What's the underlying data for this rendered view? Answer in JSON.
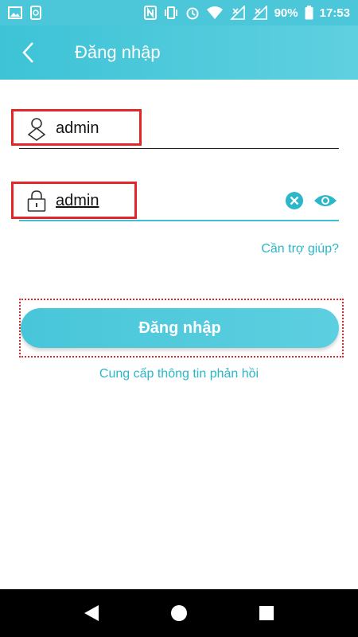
{
  "status_bar": {
    "battery": "90%",
    "time": "17:53"
  },
  "header": {
    "title": "Đăng nhập"
  },
  "form": {
    "username_value": "admin",
    "password_value": "admin",
    "help_label": "Cần trợ giúp?",
    "login_label": "Đăng nhập",
    "feedback_label": "Cung cấp thông tin phản hồi"
  },
  "colors": {
    "accent": "#3cc0d2",
    "highlight": "#e4262a"
  }
}
